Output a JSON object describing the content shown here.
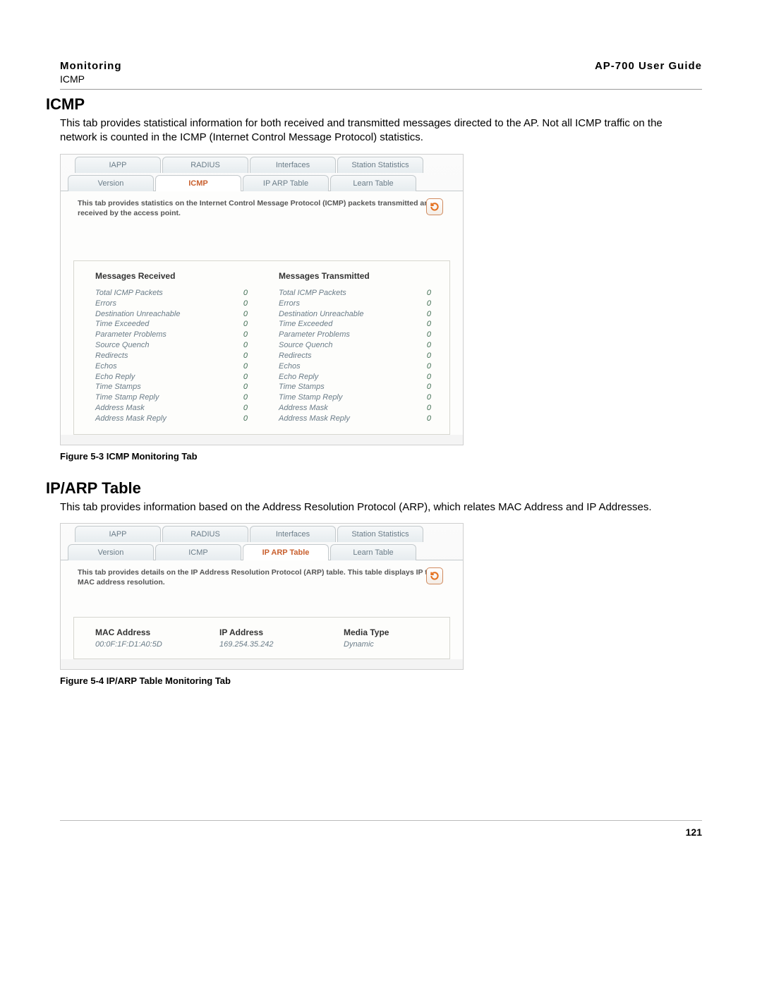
{
  "header": {
    "left_title": "Monitoring",
    "left_sub": "ICMP",
    "right_title": "AP-700 User Guide"
  },
  "section1": {
    "heading": "ICMP",
    "body": "This tab provides statistical information for both received and transmitted messages directed to the AP. Not all ICMP traffic on the network is counted in the ICMP (Internet Control Message Protocol) statistics."
  },
  "shot1": {
    "tabs_row1": [
      "IAPP",
      "RADIUS",
      "Interfaces",
      "Station Statistics"
    ],
    "tabs_row2": [
      "Version",
      "ICMP",
      "IP ARP Table",
      "Learn Table"
    ],
    "active_row2_index": 1,
    "desc": "This tab provides statistics on the Internet Control Message Protocol (ICMP) packets transmitted and received by the access point.",
    "col1_title": "Messages Received",
    "col2_title": "Messages Transmitted",
    "rows": [
      {
        "label": "Total ICMP Packets",
        "rx": "0",
        "tx": "0"
      },
      {
        "label": "Errors",
        "rx": "0",
        "tx": "0"
      },
      {
        "label": "Destination Unreachable",
        "rx": "0",
        "tx": "0"
      },
      {
        "label": "Time Exceeded",
        "rx": "0",
        "tx": "0"
      },
      {
        "label": "Parameter Problems",
        "rx": "0",
        "tx": "0"
      },
      {
        "label": "Source Quench",
        "rx": "0",
        "tx": "0"
      },
      {
        "label": "Redirects",
        "rx": "0",
        "tx": "0"
      },
      {
        "label": "Echos",
        "rx": "0",
        "tx": "0"
      },
      {
        "label": "Echo Reply",
        "rx": "0",
        "tx": "0"
      },
      {
        "label": "Time Stamps",
        "rx": "0",
        "tx": "0"
      },
      {
        "label": "Time Stamp Reply",
        "rx": "0",
        "tx": "0"
      },
      {
        "label": "Address Mask",
        "rx": "0",
        "tx": "0"
      },
      {
        "label": "Address Mask Reply",
        "rx": "0",
        "tx": "0"
      }
    ]
  },
  "caption1": "Figure 5-3 ICMP Monitoring Tab",
  "section2": {
    "heading": "IP/ARP Table",
    "body": "This tab provides information based on the Address Resolution Protocol (ARP), which relates MAC Address and IP Addresses."
  },
  "shot2": {
    "tabs_row1": [
      "IAPP",
      "RADIUS",
      "Interfaces",
      "Station Statistics"
    ],
    "tabs_row2": [
      "Version",
      "ICMP",
      "IP ARP Table",
      "Learn Table"
    ],
    "active_row2_index": 2,
    "desc": "This tab provides details on the IP Address Resolution Protocol (ARP) table. This table displays IP to MAC address resolution.",
    "cols": [
      {
        "head": "MAC Address",
        "val": "00:0F:1F:D1:A0:5D"
      },
      {
        "head": "IP Address",
        "val": "169.254.35.242"
      },
      {
        "head": "Media Type",
        "val": "Dynamic"
      }
    ]
  },
  "caption2": "Figure 5-4 IP/ARP Table Monitoring Tab",
  "page_number": "121"
}
